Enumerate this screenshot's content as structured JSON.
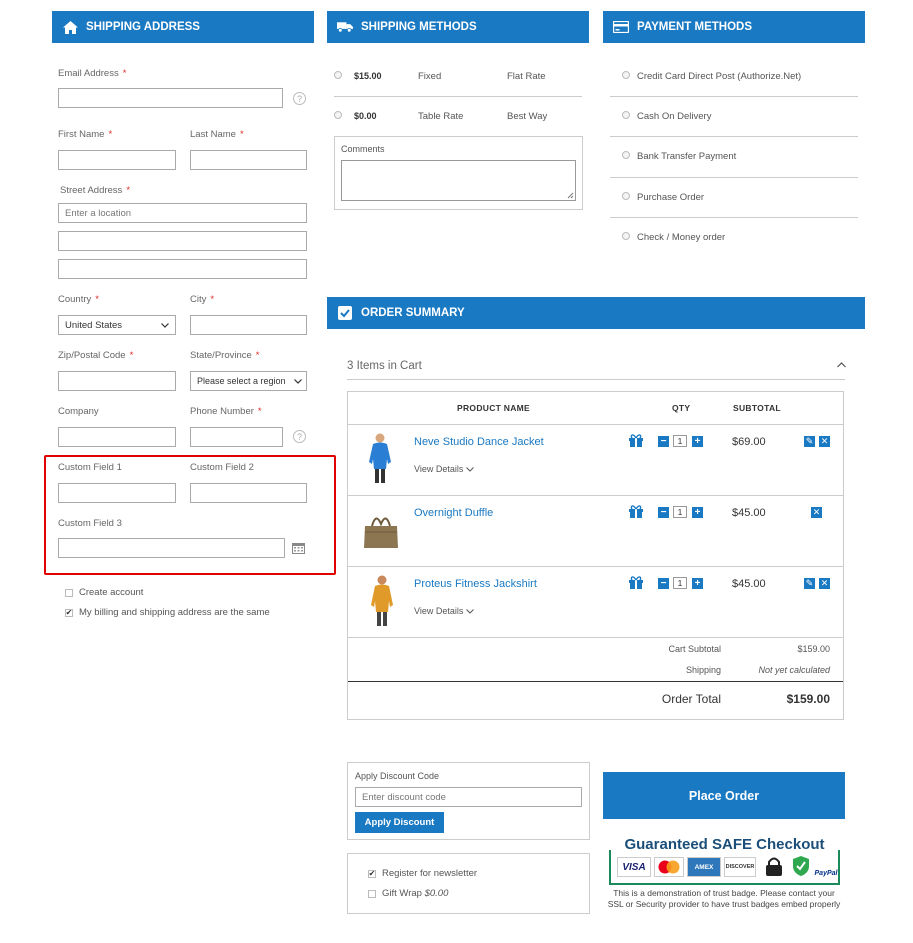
{
  "shipping_address": {
    "header": "SHIPPING ADDRESS",
    "email_label": "Email Address",
    "first_name_label": "First Name",
    "last_name_label": "Last Name",
    "street_label": "Street Address",
    "street_placeholder": "Enter a location",
    "country_label": "Country",
    "country_value": "United States",
    "city_label": "City",
    "zip_label": "Zip/Postal Code",
    "state_label": "State/Province",
    "state_value": "Please select a region",
    "company_label": "Company",
    "phone_label": "Phone Number",
    "custom1_label": "Custom Field 1",
    "custom2_label": "Custom Field 2",
    "custom3_label": "Custom Field 3",
    "create_account_label": "Create account",
    "same_address_label": "My billing and shipping address are the same",
    "required_mark": "*",
    "help_mark": "?"
  },
  "shipping_methods": {
    "header": "SHIPPING METHODS",
    "methods": [
      {
        "price": "$15.00",
        "method": "Fixed",
        "carrier": "Flat Rate"
      },
      {
        "price": "$0.00",
        "method": "Table Rate",
        "carrier": "Best Way"
      }
    ],
    "comments_label": "Comments"
  },
  "payment_methods": {
    "header": "PAYMENT METHODS",
    "options": [
      "Credit Card Direct Post (Authorize.Net)",
      "Cash On Delivery",
      "Bank Transfer Payment",
      "Purchase Order",
      "Check / Money order"
    ]
  },
  "order_summary": {
    "header": "ORDER SUMMARY",
    "items_in_cart": "3 Items in Cart",
    "col_product": "PRODUCT NAME",
    "col_qty": "QTY",
    "col_subtotal": "SUBTOTAL",
    "view_details": "View Details",
    "items": [
      {
        "name": "Neve Studio Dance Jacket",
        "qty": "1",
        "subtotal": "$69.00"
      },
      {
        "name": "Overnight Duffle",
        "qty": "1",
        "subtotal": "$45.00"
      },
      {
        "name": "Proteus Fitness Jackshirt",
        "qty": "1",
        "subtotal": "$45.00"
      }
    ],
    "cart_subtotal_label": "Cart Subtotal",
    "cart_subtotal_value": "$159.00",
    "shipping_label": "Shipping",
    "shipping_value": "Not yet calculated",
    "order_total_label": "Order Total",
    "order_total_value": "$159.00"
  },
  "discount": {
    "label": "Apply Discount Code",
    "placeholder": "Enter discount code",
    "button": "Apply Discount"
  },
  "extras": {
    "newsletter_label": "Register for newsletter",
    "gift_wrap_label": "Gift Wrap",
    "gift_wrap_price": "$0.00"
  },
  "place_order": "Place Order",
  "trust_badge": {
    "title": "Guaranteed SAFE Checkout",
    "cards": [
      "VISA",
      "MC",
      "AMEX",
      "DISCOVER",
      "",
      "",
      "PayPal"
    ],
    "note": "This is a demonstration of trust badge. Please contact your SSL or Security provider to have trust badges embed properly"
  },
  "colors": {
    "accent": "#1979c3",
    "required": "#e02b27",
    "highlight": "#e00000"
  },
  "icons": [
    "home-icon",
    "truck-icon",
    "credit-card-icon",
    "checkbox-icon",
    "gift-icon",
    "edit-icon",
    "remove-icon",
    "calendar-icon",
    "chevron-down-icon",
    "chevron-up-icon"
  ]
}
